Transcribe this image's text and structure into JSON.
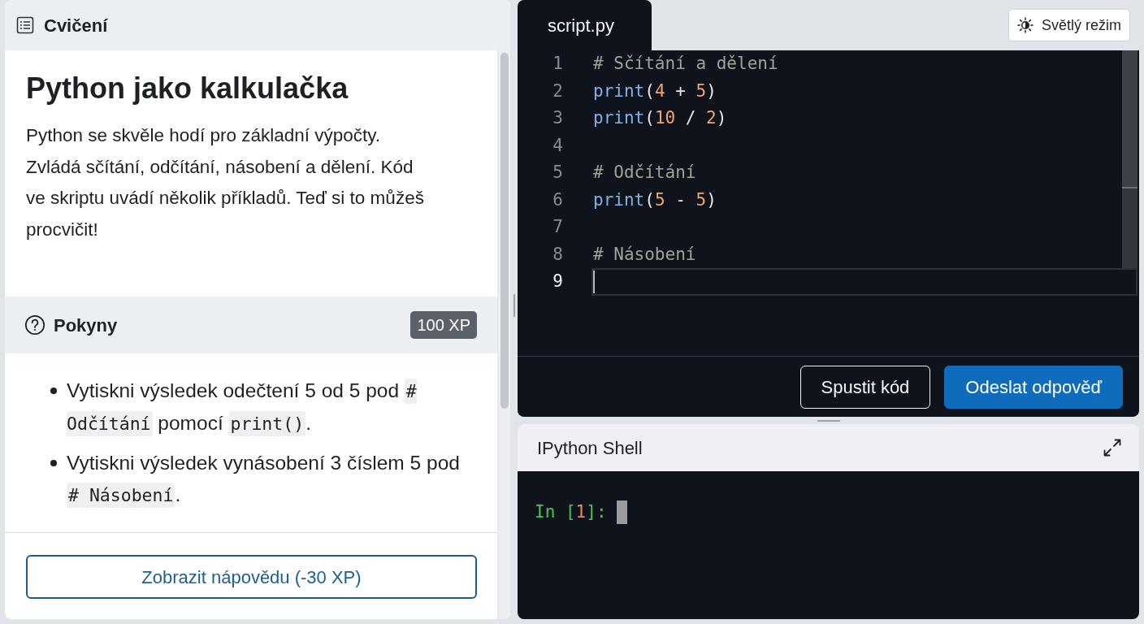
{
  "exercise": {
    "header": {
      "title": "Cvičení"
    },
    "heading": "Python jako kalkulačka",
    "description": "Python se skvěle hodí pro základní výpočty. Zvládá sčítání, odčítání, násobení a dělení. Kód ve skriptu uvádí několik příkladů. Teď si to můžeš procvičit!",
    "instructions": {
      "title": "Pokyny",
      "xp": "100 XP",
      "items": [
        {
          "segments": [
            {
              "kind": "text",
              "text": "Vytiskni výsledek odečtení 5 od 5 pod "
            },
            {
              "kind": "code",
              "text": "# Odčítání"
            },
            {
              "kind": "text",
              "text": " pomocí "
            },
            {
              "kind": "code",
              "text": "print()"
            },
            {
              "kind": "text",
              "text": "."
            }
          ]
        },
        {
          "segments": [
            {
              "kind": "text",
              "text": "Vytiskni výsledek vynásobení 3 číslem 5 pod "
            },
            {
              "kind": "code",
              "text": "# Násobení"
            },
            {
              "kind": "text",
              "text": "."
            }
          ]
        }
      ]
    },
    "hint_button": "Zobrazit nápovědu (-30 XP)"
  },
  "editor": {
    "tabs": [
      {
        "label": "script.py",
        "selected": true
      }
    ],
    "theme_button": "Světlý režim",
    "lines": [
      {
        "number": "1",
        "current": false,
        "tokens": [
          {
            "kind": "comment",
            "text": "# Sčítání a dělení"
          }
        ]
      },
      {
        "number": "2",
        "current": false,
        "tokens": [
          {
            "kind": "builtin",
            "text": "print"
          },
          {
            "kind": "punct",
            "text": "("
          },
          {
            "kind": "number",
            "text": "4"
          },
          {
            "kind": "operator",
            "text": " + "
          },
          {
            "kind": "number",
            "text": "5"
          },
          {
            "kind": "punct",
            "text": ")"
          }
        ]
      },
      {
        "number": "3",
        "current": false,
        "tokens": [
          {
            "kind": "builtin",
            "text": "print"
          },
          {
            "kind": "punct",
            "text": "("
          },
          {
            "kind": "number",
            "text": "10"
          },
          {
            "kind": "operator",
            "text": " / "
          },
          {
            "kind": "number",
            "text": "2"
          },
          {
            "kind": "punct",
            "text": ")"
          }
        ]
      },
      {
        "number": "4",
        "current": false
      },
      {
        "number": "5",
        "current": false,
        "tokens": [
          {
            "kind": "comment",
            "text": "# Odčítání"
          }
        ]
      },
      {
        "number": "6",
        "current": false,
        "tokens": [
          {
            "kind": "builtin",
            "text": "print"
          },
          {
            "kind": "punct",
            "text": "("
          },
          {
            "kind": "number",
            "text": "5"
          },
          {
            "kind": "operator",
            "text": " - "
          },
          {
            "kind": "number",
            "text": "5"
          },
          {
            "kind": "punct",
            "text": ")"
          }
        ]
      },
      {
        "number": "7",
        "current": false
      },
      {
        "number": "8",
        "current": false,
        "tokens": [
          {
            "kind": "comment",
            "text": "# Násobení"
          }
        ]
      },
      {
        "number": "9",
        "current": true
      }
    ],
    "buttons": [
      {
        "label": "Spustit kód",
        "kind": "outline"
      },
      {
        "label": "Odeslat odpověď",
        "kind": "primary"
      }
    ]
  },
  "shell": {
    "title": "IPython Shell",
    "prompt": [
      {
        "kind": "prompt",
        "text": "In ["
      },
      {
        "kind": "number",
        "text": "1"
      },
      {
        "kind": "prompt",
        "text": "]:"
      }
    ]
  }
}
